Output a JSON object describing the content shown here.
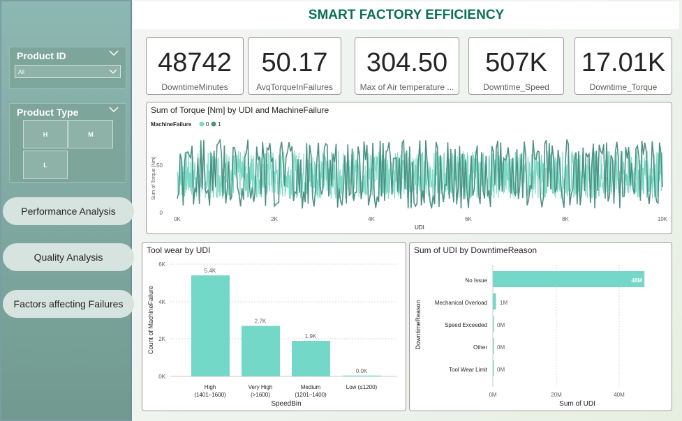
{
  "dashboard": {
    "title": "SMART FACTORY EFFICIENCY"
  },
  "colors": {
    "sidebar_bg": "#7fa9a1",
    "accent_title": "#0b6f57",
    "series_0": "#7ed9c6",
    "series_1": "#4c9183",
    "bar": "#73d8c8"
  },
  "sidebar": {
    "product_id": {
      "title": "Product ID",
      "selected": "All",
      "chevron_icon": "chevron-down-icon"
    },
    "product_type": {
      "title": "Product Type",
      "options": [
        "H",
        "M",
        "L"
      ],
      "chevron_icon": "chevron-down-icon"
    },
    "nav": [
      {
        "label": "Performance Analysis"
      },
      {
        "label": "Quality Analysis"
      },
      {
        "label": "Factors affecting Failures"
      }
    ]
  },
  "kpis": [
    {
      "value": "48742",
      "label": "DowntimeMinutes"
    },
    {
      "value": "50.17",
      "label": "AvqTorqueInFailures"
    },
    {
      "value": "304.50",
      "label": "Max of Air temperature ..."
    },
    {
      "value": "507K",
      "label": "Downtime_Speed"
    },
    {
      "value": "17.01K",
      "label": "Downtime_Torque"
    }
  ],
  "torque_chart": {
    "title": "Sum of Torque [Nm] by UDI and MachineFailure",
    "legend_title": "MachineFailure",
    "legend_items": [
      "0",
      "1"
    ],
    "ylabel": "Sum of Torque [Nm]",
    "xlabel": "UDI",
    "x_ticks": [
      "0K",
      "2K",
      "4K",
      "6K",
      "8K",
      "10K"
    ],
    "y_ticks": [
      "0",
      "50"
    ]
  },
  "toolwear_chart": {
    "title": "Tool wear by UDI",
    "ylabel": "Count of MachineFailure",
    "xlabel": "SpeedBin",
    "y_ticks": [
      "0K",
      "2K",
      "4K",
      "6K"
    ],
    "bars": [
      {
        "line1": "High",
        "line2": "(1401–1600)",
        "label": "5.4K"
      },
      {
        "line1": "Very High",
        "line2": "(>1600)",
        "label": "2.7K"
      },
      {
        "line1": "Medium",
        "line2": "(1201–1400)",
        "label": "1.9K"
      },
      {
        "line1": "Low (≤1200)",
        "line2": "",
        "label": "0.0K"
      }
    ]
  },
  "downtime_chart": {
    "title": "Sum of UDI by DowntimeReason",
    "ylabel": "DowntimeReason",
    "xlabel": "Sum of UDI",
    "x_ticks": [
      "0M",
      "20M",
      "40M"
    ],
    "bars": [
      {
        "category": "No Issue",
        "label": "48M"
      },
      {
        "category": "Mechanical Overload",
        "label": "1M"
      },
      {
        "category": "Speed Exceeded",
        "label": "0M"
      },
      {
        "category": "Other",
        "label": "0M"
      },
      {
        "category": "Tool Wear Limit",
        "label": "0M"
      }
    ]
  },
  "chart_data": [
    {
      "type": "line",
      "title": "Sum of Torque [Nm] by UDI and MachineFailure",
      "xlabel": "UDI",
      "ylabel": "Sum of Torque [Nm]",
      "xlim": [
        0,
        10000
      ],
      "ylim": [
        0,
        80
      ],
      "x_ticks": [
        0,
        2000,
        4000,
        6000,
        8000,
        10000
      ],
      "y_ticks": [
        0,
        50
      ],
      "legend": "top-left",
      "series": [
        {
          "name": "0",
          "values_range": [
            15,
            65
          ]
        },
        {
          "name": "1",
          "values_range": [
            5,
            77
          ]
        }
      ]
    },
    {
      "type": "bar",
      "title": "Tool wear by UDI",
      "xlabel": "SpeedBin",
      "ylabel": "Count of MachineFailure",
      "categories": [
        "High (1401–1600)",
        "Very High (>1600)",
        "Medium (1201–1400)",
        "Low (≤1200)"
      ],
      "values": [
        5400,
        2700,
        1900,
        0
      ],
      "ylim": [
        0,
        6000
      ]
    },
    {
      "type": "bar",
      "orientation": "horizontal",
      "title": "Sum of UDI by DowntimeReason",
      "xlabel": "Sum of UDI",
      "ylabel": "DowntimeReason",
      "categories": [
        "No Issue",
        "Mechanical Overload",
        "Speed Exceeded",
        "Other",
        "Tool Wear Limit"
      ],
      "values": [
        48,
        1,
        0,
        0,
        0
      ],
      "unit": "M",
      "xlim": [
        0,
        50
      ]
    }
  ]
}
